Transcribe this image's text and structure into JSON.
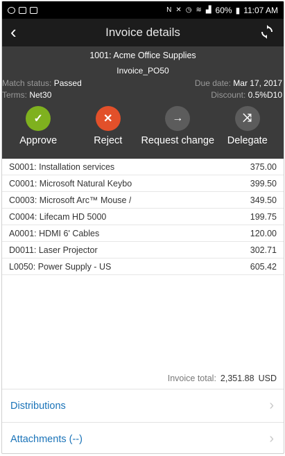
{
  "statusbar": {
    "right_text": "60%",
    "time": "11:07 AM"
  },
  "header": {
    "title": "Invoice details"
  },
  "invoice": {
    "vendor": "1001: Acme Office Supplies",
    "number": "Invoice_PO50",
    "match_status_label": "Match status:",
    "match_status_value": "Passed",
    "due_date_label": "Due date:",
    "due_date_value": "Mar 17, 2017",
    "terms_label": "Terms:",
    "terms_value": "Net30",
    "discount_label": "Discount:",
    "discount_value": "0.5%D10"
  },
  "actions": [
    {
      "label": "Approve",
      "icon": "check-icon"
    },
    {
      "label": "Reject",
      "icon": "close-icon"
    },
    {
      "label": "Request change",
      "icon": "arrow-right-icon"
    },
    {
      "label": "Delegate",
      "icon": "shuffle-icon"
    }
  ],
  "lines": [
    {
      "desc": "S0001: Installation services",
      "amount": "375.00"
    },
    {
      "desc": "C0001: Microsoft Natural Keybo",
      "amount": "399.50"
    },
    {
      "desc": "C0003: Microsoft Arc™ Mouse /",
      "amount": "349.50"
    },
    {
      "desc": "C0004: Lifecam HD 5000",
      "amount": "199.75"
    },
    {
      "desc": "A0001: HDMI 6' Cables",
      "amount": "120.00"
    },
    {
      "desc": "D0011: Laser Projector",
      "amount": "302.71"
    },
    {
      "desc": "L0050: Power Supply - US",
      "amount": "605.42"
    }
  ],
  "total": {
    "label": "Invoice total:",
    "amount": "2,351.88",
    "currency": "USD"
  },
  "links": {
    "distributions": "Distributions",
    "attachments": "Attachments (--)"
  },
  "colors": {
    "approve": "#7fb11f",
    "reject": "#e2502a",
    "neutral": "#5c5c5c",
    "link": "#1a73b8",
    "header_bg": "#3b3b3b"
  }
}
